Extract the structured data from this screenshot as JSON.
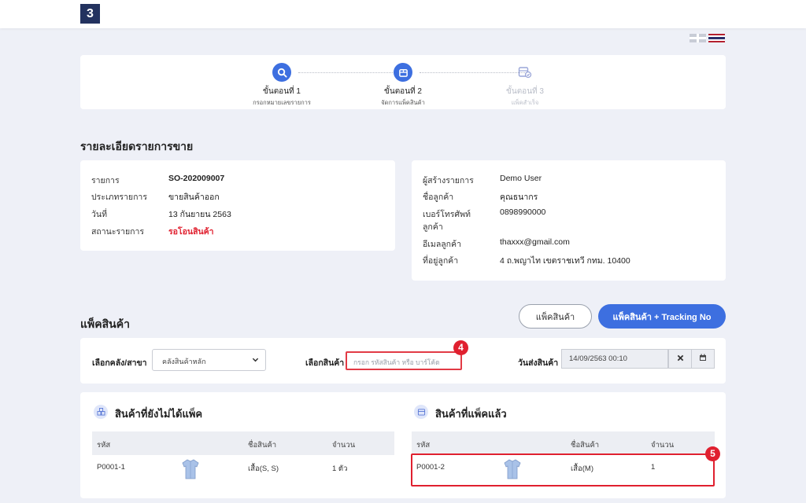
{
  "header": {
    "logo_text": "3"
  },
  "stepper": {
    "steps": [
      {
        "title": "ขั้นตอนที่ 1",
        "subtitle": "กรอกหมายเลขรายการ",
        "icon": "search-icon",
        "state": "done"
      },
      {
        "title": "ขั้นตอนที่ 2",
        "subtitle": "จัดการแพ็คสินค้า",
        "icon": "box-icon",
        "state": "active"
      },
      {
        "title": "ขั้นตอนที่ 3",
        "subtitle": "แพ็คสำเร็จ",
        "icon": "box-check-icon",
        "state": "inactive"
      }
    ]
  },
  "sale_details": {
    "section_title": "รายละเอียดรายการขาย",
    "left": [
      {
        "label": "รายการ",
        "value": "SO-202009007"
      },
      {
        "label": "ประเภทรายการ",
        "value": "ขายสินค้าออก"
      },
      {
        "label": "วันที่",
        "value": "13 กันยายน 2563"
      },
      {
        "label": "สถานะรายการ",
        "value": "รอโอนสินค้า"
      }
    ],
    "right": [
      {
        "label": "ผู้สร้างรายการ",
        "value": "Demo User"
      },
      {
        "label": "ชื่อลูกค้า",
        "value": "คุณธนากร"
      },
      {
        "label": "เบอร์โทรศัพท์",
        "label2": "ลูกค้า",
        "value": "0898990000"
      },
      {
        "label": "อีเมลลูกค้า",
        "value": "thaxxx@gmail.com"
      },
      {
        "label": "ที่อยู่ลูกค้า",
        "value": "4 ถ.พญาไท เขตราชเทวี กทม. 10400"
      }
    ]
  },
  "pack": {
    "section_title": "แพ็คสินค้า",
    "btn_pack": "แพ็คสินค้า",
    "btn_pack_tracking": "แพ็คสินค้า + Tracking No"
  },
  "filters": {
    "warehouse_label": "เลือกคลัง/สาขา",
    "warehouse_value": "คลังสินค้าหลัก",
    "product_label": "เลือกสินค้า",
    "product_placeholder": "กรอก รหัสสินค้า หรือ บาร์โค้ด",
    "ship_date_label": "วันส่งสินค้า",
    "ship_date_value": "14/09/2563 00:10"
  },
  "badges": {
    "four": "4",
    "five": "5"
  },
  "unpacked": {
    "title": "สินค้าที่ยังไม่ได้แพ็ค",
    "columns": [
      "รหัส",
      "ชื่อสินค้า",
      "จำนวน"
    ],
    "rows": [
      {
        "code": "P0001-1",
        "name": "เสื้อ(S, S)",
        "qty": "1 ตัว"
      }
    ]
  },
  "packed": {
    "title": "สินค้าที่แพ็คแล้ว",
    "columns": [
      "รหัส",
      "ชื่อสินค้า",
      "จำนวน"
    ],
    "rows": [
      {
        "code": "P0001-2",
        "name": "เสื้อ(M)",
        "qty": "1"
      }
    ]
  },
  "colors": {
    "primary": "#3d6fe0",
    "danger": "#e0202f",
    "background": "#eef0f7",
    "navy": "#23325f"
  }
}
